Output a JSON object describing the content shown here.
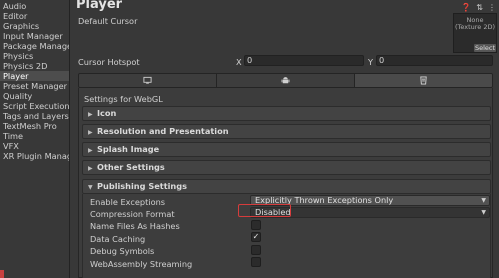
{
  "sidebar": {
    "items": [
      {
        "label": "Audio",
        "active": false
      },
      {
        "label": "Editor",
        "active": false
      },
      {
        "label": "Graphics",
        "active": false
      },
      {
        "label": "Input Manager",
        "active": false
      },
      {
        "label": "Package Manager",
        "active": false
      },
      {
        "label": "Physics",
        "active": false
      },
      {
        "label": "Physics 2D",
        "active": false
      },
      {
        "label": "Player",
        "active": true
      },
      {
        "label": "Preset Manager",
        "active": false
      },
      {
        "label": "Quality",
        "active": false
      },
      {
        "label": "Script Execution Order",
        "active": false
      },
      {
        "label": "Tags and Layers",
        "active": false
      },
      {
        "label": "TextMesh Pro",
        "active": false
      },
      {
        "label": "Time",
        "active": false
      },
      {
        "label": "VFX",
        "active": false
      },
      {
        "label": "XR Plugin Management",
        "active": false
      }
    ]
  },
  "header": {
    "title": "Player",
    "icons": [
      "help-icon",
      "preset-icon",
      "more-icon"
    ]
  },
  "cursor": {
    "default_label": "Default Cursor",
    "preview_text": "None\n(Texture 2D)",
    "select_label": "Select",
    "hotspot_label": "Cursor Hotspot",
    "x_label": "X",
    "x_value": "0",
    "y_label": "Y",
    "y_value": "0"
  },
  "tabs": [
    {
      "icon": "monitor-icon",
      "active": false
    },
    {
      "icon": "android-icon",
      "active": false
    },
    {
      "icon": "webgl-icon",
      "active": true
    }
  ],
  "settings_for": "Settings for WebGL",
  "foldouts": {
    "icon": "Icon",
    "resolution": "Resolution and Presentation",
    "splash": "Splash Image",
    "other": "Other Settings",
    "publishing": "Publishing Settings"
  },
  "publishing": {
    "enable_exceptions_label": "Enable Exceptions",
    "enable_exceptions_value": "Explicitly Thrown Exceptions Only",
    "compression_label": "Compression Format",
    "compression_value": "Disabled",
    "name_files_label": "Name Files As Hashes",
    "name_files_checked": false,
    "data_caching_label": "Data Caching",
    "data_caching_checked": true,
    "debug_symbols_label": "Debug Symbols",
    "debug_symbols_checked": false,
    "wasm_streaming_label": "WebAssembly Streaming",
    "wasm_streaming_checked": false
  },
  "colors": {
    "highlight": "#d63c3c",
    "background": "#383838",
    "selected": "#4d4d4d"
  }
}
